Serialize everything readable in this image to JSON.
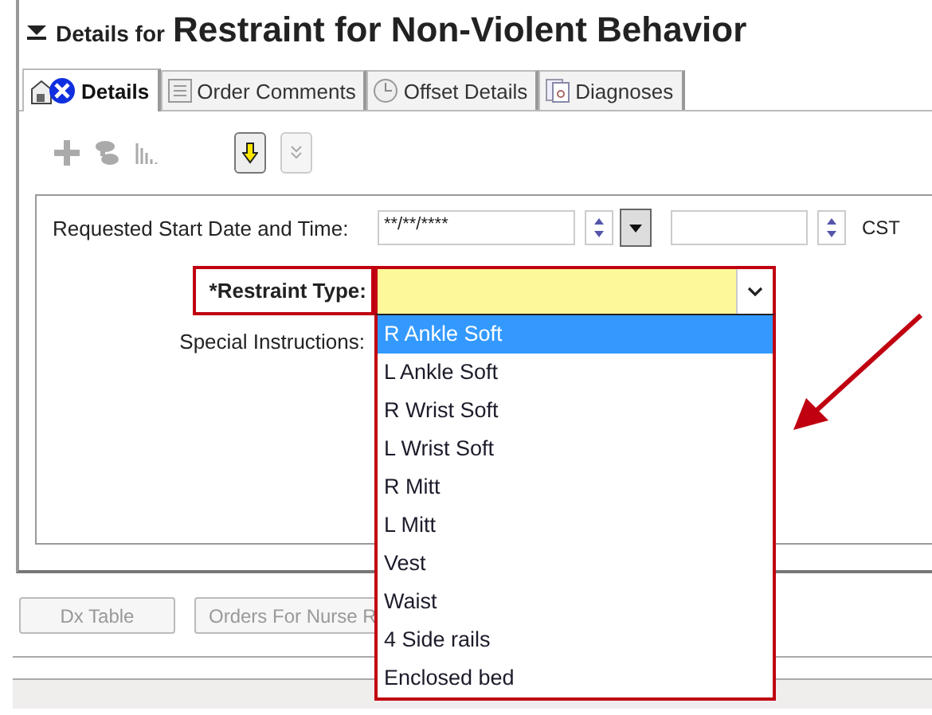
{
  "header": {
    "prefix": "Details for",
    "title": "Restraint for Non-Violent Behavior"
  },
  "tabs": [
    {
      "label": "Details",
      "selected": true
    },
    {
      "label": "Order Comments",
      "selected": false
    },
    {
      "label": "Offset Details",
      "selected": false
    },
    {
      "label": "Diagnoses",
      "selected": false
    }
  ],
  "form": {
    "start_label": "Requested Start Date and Time:",
    "date_value": "**/**/****",
    "timezone": "CST",
    "restraint_label": "*Restraint Type:",
    "special_label": "Special Instructions:"
  },
  "dropdown": {
    "options": [
      {
        "label": "R Ankle Soft",
        "selected": true
      },
      {
        "label": "L Ankle Soft",
        "selected": false
      },
      {
        "label": "R Wrist Soft",
        "selected": false
      },
      {
        "label": "L Wrist Soft",
        "selected": false
      },
      {
        "label": "R Mitt",
        "selected": false
      },
      {
        "label": "L Mitt",
        "selected": false
      },
      {
        "label": "Vest",
        "selected": false
      },
      {
        "label": "Waist",
        "selected": false
      },
      {
        "label": "4 Side rails",
        "selected": false
      },
      {
        "label": "Enclosed bed",
        "selected": false
      }
    ]
  },
  "buttons": [
    {
      "label": "Dx Table",
      "disabled": true
    },
    {
      "label": "Orders For Nurse R",
      "disabled": true
    }
  ]
}
